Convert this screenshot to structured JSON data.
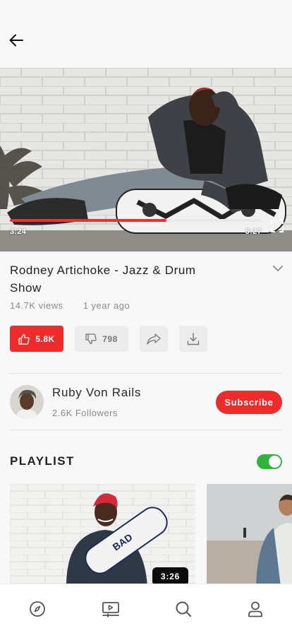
{
  "video": {
    "current_time": "3:24",
    "total_time": "5:27",
    "progress_fraction": 0.62,
    "title": "Rodney Artichoke - Jazz & Drum Show",
    "views": "14.7K views",
    "age": "1 year ago"
  },
  "actions": {
    "likes": "5.8K",
    "dislikes": "798"
  },
  "channel": {
    "name": "Ruby Von Rails",
    "followers": "2.6K Followers",
    "subscribe_label": "Subscribe"
  },
  "playlist": {
    "heading": "PLAYLIST",
    "autoplay_on": true,
    "items": [
      {
        "duration": "3:26"
      },
      {
        "duration": ""
      }
    ]
  },
  "icons": {
    "back": "arrow-left-icon",
    "fullscreen": "fullscreen-icon",
    "expand": "chevron-down-icon",
    "like": "thumbs-up-icon",
    "dislike": "thumbs-down-icon",
    "share": "share-icon",
    "download": "download-icon",
    "nav": [
      "compass-icon",
      "video-library-icon",
      "search-icon",
      "user-icon"
    ]
  },
  "colors": {
    "accent": "#ee2a2a",
    "toggle_on": "#2fb53b",
    "muted_text": "#8a8a8a"
  }
}
